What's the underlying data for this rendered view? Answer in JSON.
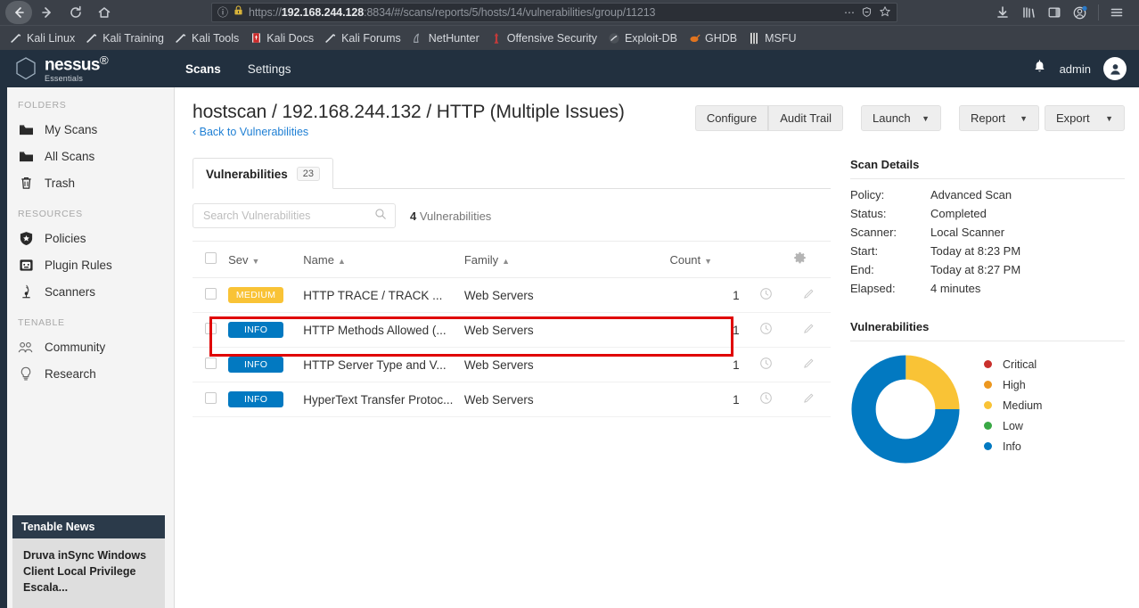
{
  "browser": {
    "nav": {
      "back_label": "Back",
      "forward_label": "Forward",
      "reload_label": "Reload",
      "home_label": "Home"
    },
    "url": {
      "scheme": "https://",
      "host": "192.168.244.128",
      "rest": ":8834/#/scans/reports/5/hosts/14/vulnerabilities/group/11213",
      "full": "https://192.168.244.128:8834/#/scans/reports/5/hosts/14/vulnerabilities/group/11213"
    },
    "toolbar_icons": [
      "page-info-icon",
      "warning-lock-icon",
      "more-options-icon",
      "reader-shield-icon",
      "bookmark-star-icon",
      "downloads-icon",
      "library-icon",
      "sidebar-icon",
      "account-icon",
      "menu-icon"
    ],
    "bookmarks": [
      {
        "label": "Kali Linux",
        "icon": "dragon-tail-icon"
      },
      {
        "label": "Kali Training",
        "icon": "dragon-tail-icon"
      },
      {
        "label": "Kali Tools",
        "icon": "dragon-tail-icon"
      },
      {
        "label": "Kali Docs",
        "icon": "book-icon"
      },
      {
        "label": "Kali Forums",
        "icon": "dragon-tail-icon"
      },
      {
        "label": "NetHunter",
        "icon": "nethunter-icon"
      },
      {
        "label": "Offensive Security",
        "icon": "offsec-icon"
      },
      {
        "label": "Exploit-DB",
        "icon": "exploitdb-icon"
      },
      {
        "label": "GHDB",
        "icon": "ghdb-icon"
      },
      {
        "label": "MSFU",
        "icon": "msfu-icon"
      }
    ]
  },
  "header": {
    "brand": "nessus",
    "brand_sub": "Essentials",
    "nav": [
      {
        "label": "Scans",
        "active": true
      },
      {
        "label": "Settings",
        "active": false
      }
    ],
    "notifications_icon": "bell-icon",
    "username": "admin"
  },
  "sidebar": {
    "sections": [
      {
        "title": "FOLDERS",
        "items": [
          {
            "label": "My Scans",
            "icon": "folder-icon"
          },
          {
            "label": "All Scans",
            "icon": "folder-icon"
          },
          {
            "label": "Trash",
            "icon": "trash-icon"
          }
        ]
      },
      {
        "title": "RESOURCES",
        "items": [
          {
            "label": "Policies",
            "icon": "shield-star-icon"
          },
          {
            "label": "Plugin Rules",
            "icon": "plugin-icon"
          },
          {
            "label": "Scanners",
            "icon": "scanner-icon"
          }
        ]
      },
      {
        "title": "TENABLE",
        "items": [
          {
            "label": "Community",
            "icon": "people-icon"
          },
          {
            "label": "Research",
            "icon": "lightbulb-icon"
          }
        ]
      }
    ],
    "news": {
      "title": "Tenable News",
      "headline": "Druva inSync Windows Client Local Privilege Escala..."
    }
  },
  "page": {
    "title": "hostscan / 192.168.244.132 / HTTP (Multiple Issues)",
    "back_link": "‹ Back to Vulnerabilities",
    "actions": [
      {
        "label": "Configure",
        "has_caret": false
      },
      {
        "label": "Audit Trail",
        "has_caret": false
      },
      {
        "label": "Launch",
        "has_caret": true
      },
      {
        "label": "Report",
        "has_caret": true
      },
      {
        "label": "Export",
        "has_caret": true
      }
    ]
  },
  "tabs": [
    {
      "label": "Vulnerabilities",
      "badge": "23",
      "active": true
    }
  ],
  "search": {
    "placeholder": "Search Vulnerabilities",
    "value": "",
    "icon": "search-icon"
  },
  "results_count": {
    "number": "4",
    "label": "Vulnerabilities"
  },
  "table": {
    "columns": [
      {
        "label": "Sev",
        "sort": "desc"
      },
      {
        "label": "Name",
        "sort": "asc"
      },
      {
        "label": "Family",
        "sort": "asc"
      },
      {
        "label": "Count",
        "sort": "desc"
      }
    ],
    "settings_icon": "gear-icon",
    "rows": [
      {
        "severity": "MEDIUM",
        "severity_class": "medium",
        "name": "HTTP TRACE / TRACK ...",
        "family": "Web Servers",
        "count": "1",
        "highlighted": false
      },
      {
        "severity": "INFO",
        "severity_class": "info",
        "name": "HTTP Methods Allowed (...",
        "family": "Web Servers",
        "count": "1",
        "highlighted": false
      },
      {
        "severity": "INFO",
        "severity_class": "info",
        "name": "HTTP Server Type and V...",
        "family": "Web Servers",
        "count": "1",
        "highlighted": true
      },
      {
        "severity": "INFO",
        "severity_class": "info",
        "name": "HyperText Transfer Protoc...",
        "family": "Web Servers",
        "count": "1",
        "highlighted": false
      }
    ]
  },
  "scan_details": {
    "title": "Scan Details",
    "items": [
      {
        "key": "Policy:",
        "value": "Advanced Scan"
      },
      {
        "key": "Status:",
        "value": "Completed"
      },
      {
        "key": "Scanner:",
        "value": "Local Scanner"
      },
      {
        "key": "Start:",
        "value": "Today at 8:23 PM"
      },
      {
        "key": "End:",
        "value": "Today at 8:27 PM"
      },
      {
        "key": "Elapsed:",
        "value": "4 minutes"
      }
    ]
  },
  "vulnerabilities_panel": {
    "title": "Vulnerabilities"
  },
  "chart_data": {
    "type": "pie",
    "title": "Vulnerabilities",
    "labels": [
      "Critical",
      "High",
      "Medium",
      "Low",
      "Info"
    ],
    "values": [
      0,
      0,
      1,
      0,
      3
    ],
    "colors": [
      "#c9302c",
      "#ec971f",
      "#f9c336",
      "#39a845",
      "#0279c1"
    ],
    "legend_position": "right",
    "donut": true,
    "inner_radius_ratio": 0.5
  },
  "colors": {
    "chrome": "#3b4048",
    "nessus_header": "#22303f",
    "accent_blue": "#1e7fd4",
    "info_blue": "#0279c1",
    "medium_yellow": "#f9c336",
    "highlight_red": "#e00000",
    "sidebar_bg": "#f4f4f4"
  }
}
